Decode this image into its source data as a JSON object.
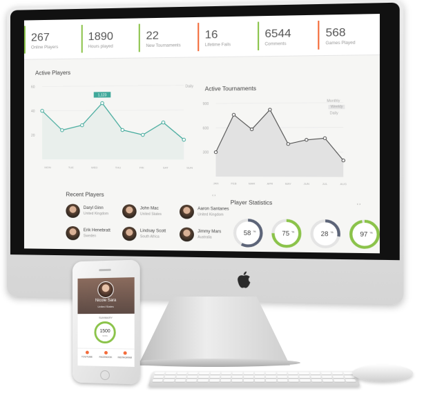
{
  "stats": [
    {
      "value": "267",
      "label": "Online Players",
      "accent": "#8bc34a"
    },
    {
      "value": "1890",
      "label": "Hours played",
      "accent": "#8bc34a"
    },
    {
      "value": "22",
      "label": "New Tournaments",
      "accent": "#8bc34a"
    },
    {
      "value": "16",
      "label": "Lifetime Fails",
      "accent": "#f36b3a"
    },
    {
      "value": "6544",
      "label": "Comments",
      "accent": "#8bc34a"
    },
    {
      "value": "568",
      "label": "Games Played",
      "accent": "#f36b3a"
    }
  ],
  "active_players": {
    "title": "Active Players",
    "range": "Daily",
    "tooltip": "1,123",
    "y_ticks": [
      "60",
      "40",
      "20"
    ],
    "chart_data": {
      "type": "line",
      "categories": [
        "MON",
        "TUE",
        "WED",
        "THU",
        "FRI",
        "SAT",
        "SUN"
      ],
      "values": [
        40,
        24,
        28,
        46,
        24,
        20,
        30,
        16
      ],
      "ylim": [
        0,
        60
      ]
    }
  },
  "active_tournaments": {
    "title": "Active Tournaments",
    "range": "Monthly",
    "range_options": [
      "Weekly",
      "Daily"
    ],
    "y_ticks": [
      "900",
      "600",
      "300"
    ],
    "chart_data": {
      "type": "area",
      "categories": [
        "JAN",
        "FEB",
        "MAR",
        "APR",
        "MAY",
        "JUN",
        "JUL",
        "AUG"
      ],
      "values": [
        300,
        760,
        580,
        820,
        400,
        450,
        470,
        200
      ],
      "ylim": [
        0,
        900
      ]
    }
  },
  "recent_players": {
    "title": "Recent Players",
    "players": [
      {
        "name": "Daryl Ginn",
        "location": "United Kingdom"
      },
      {
        "name": "John Mac",
        "location": "United States"
      },
      {
        "name": "Aaron Santanes",
        "location": "United Kingdom"
      },
      {
        "name": "Erik Henebratt",
        "location": "Sweden"
      },
      {
        "name": "Lindsay Scott",
        "location": "South Africa"
      },
      {
        "name": "Jimmy Mars",
        "location": "Australia"
      }
    ]
  },
  "player_statistics": {
    "title": "Player Statistics",
    "items": [
      {
        "value": 58,
        "label": "58",
        "color": "#5c6478"
      },
      {
        "value": 75,
        "label": "75",
        "color": "#8bc34a"
      },
      {
        "value": 28,
        "label": "28",
        "color": "#5c6478"
      },
      {
        "value": 97,
        "label": "97",
        "color": "#8bc34a"
      }
    ]
  },
  "phone": {
    "name": "Nicole Sara",
    "subtitle": "United States",
    "section": "SUMMARY",
    "value": "1500",
    "unit": "WINS",
    "nav": [
      "YOUTUBE",
      "FACEBOOK",
      "INSTAGRAM"
    ]
  },
  "colors": {
    "purple": "#8a2aa3",
    "teal": "#3fa89a",
    "green": "#8bc34a",
    "orange": "#f36b3a"
  }
}
